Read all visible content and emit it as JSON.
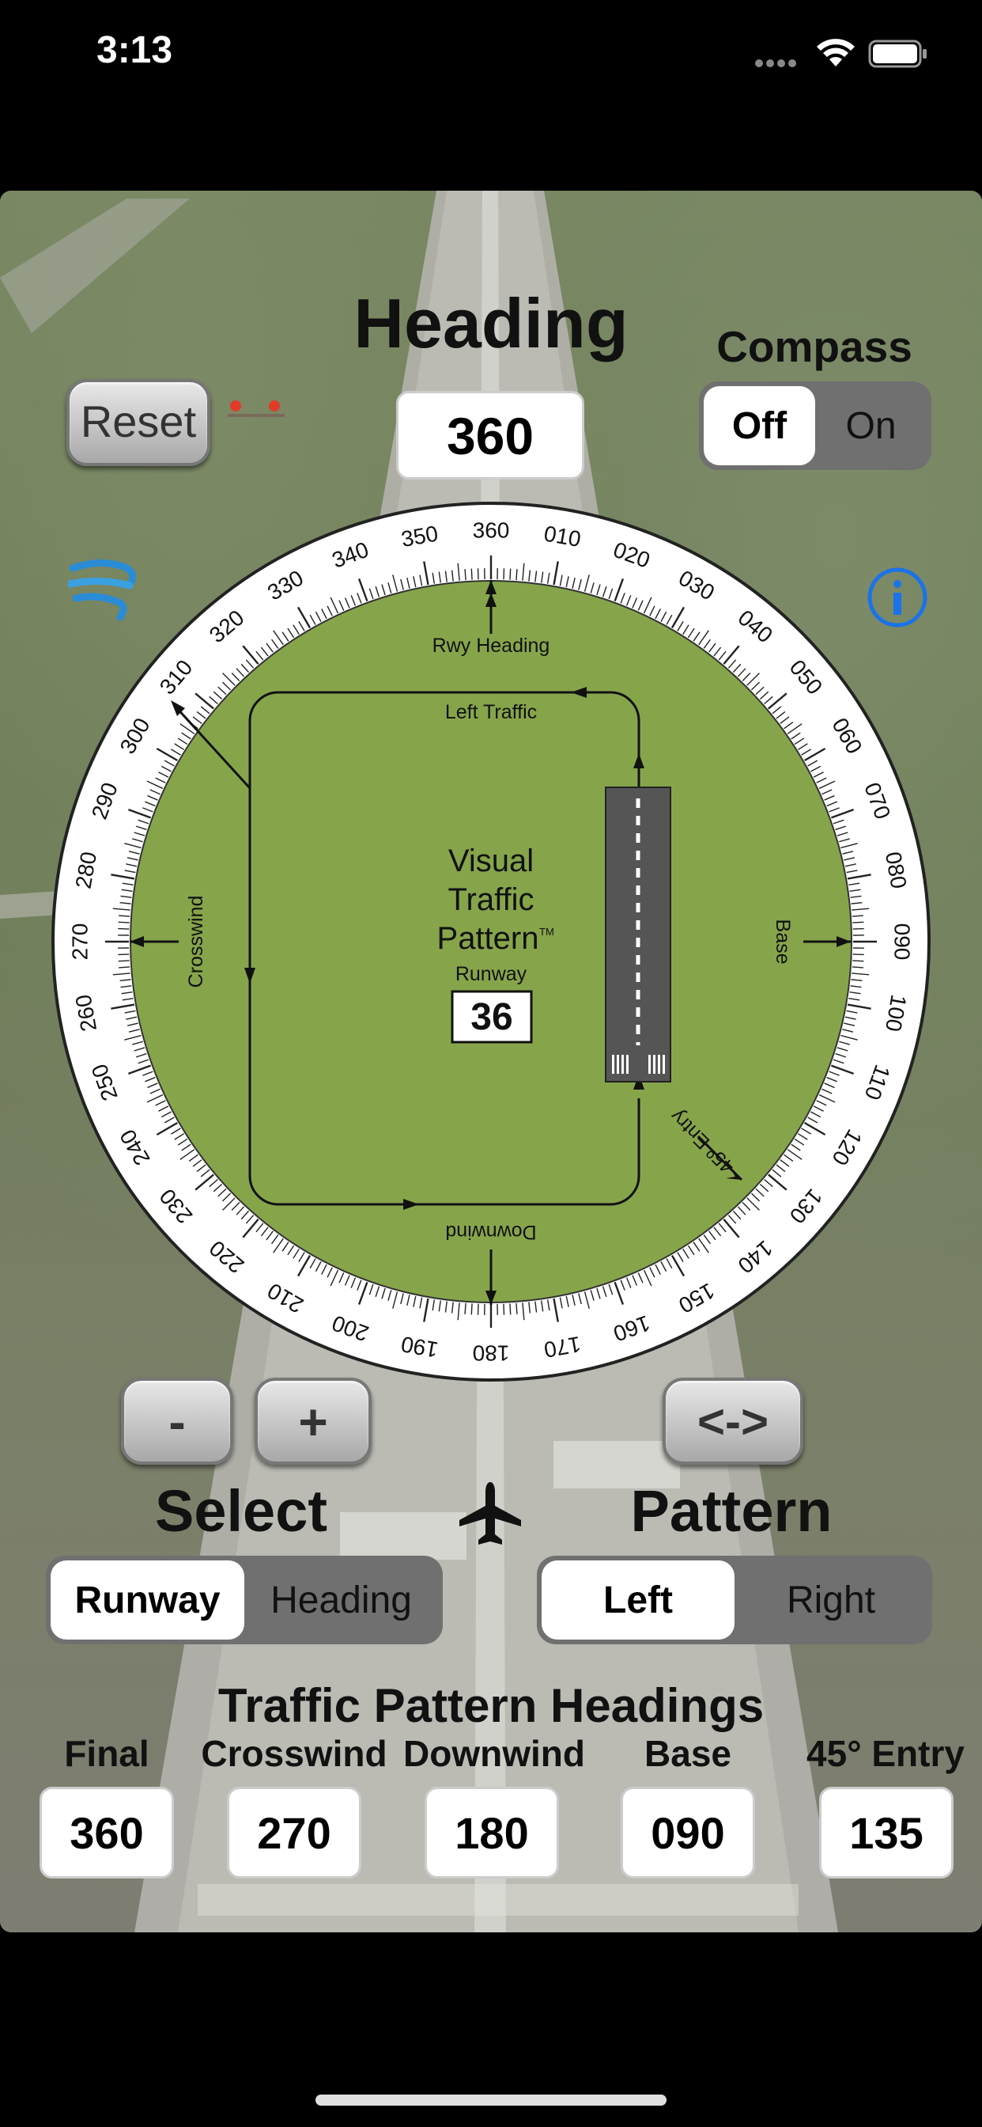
{
  "status_bar": {
    "time": "3:13"
  },
  "header": {
    "title": "Heading",
    "heading_value": "360",
    "compass_label": "Compass",
    "compass_options": [
      "Off",
      "On"
    ],
    "compass_selected": "Off",
    "reset_label": "Reset"
  },
  "dial": {
    "degree_labels": [
      "360",
      "010",
      "020",
      "030",
      "040",
      "050",
      "060",
      "070",
      "080",
      "090",
      "100",
      "110",
      "120",
      "130",
      "140",
      "150",
      "160",
      "170",
      "180",
      "190",
      "200",
      "210",
      "220",
      "230",
      "240",
      "250",
      "260",
      "270",
      "280",
      "290",
      "300",
      "310",
      "320",
      "330",
      "340",
      "350"
    ],
    "rwy_heading_label": "Rwy Heading",
    "left_traffic_label": "Left Traffic",
    "crosswind_label": "Crosswind",
    "base_label": "Base",
    "downwind_label": "Downwind",
    "entry_label": "45º Entry",
    "center_line1": "Visual",
    "center_line2": "Traffic",
    "center_line3": "Pattern",
    "trademark": "TM",
    "runway_label": "Runway",
    "runway_number": "36"
  },
  "controls": {
    "minus_label": "-",
    "plus_label": "+",
    "swap_label": "<->",
    "select_label": "Select",
    "pattern_label": "Pattern",
    "select_options": [
      "Runway",
      "Heading"
    ],
    "select_selected": "Runway",
    "pattern_options": [
      "Left",
      "Right"
    ],
    "pattern_selected": "Left"
  },
  "traffic_pattern": {
    "title": "Traffic Pattern Headings",
    "columns": [
      {
        "label": "Final",
        "value": "360"
      },
      {
        "label": "Crosswind",
        "value": "270"
      },
      {
        "label": "Downwind",
        "value": "180"
      },
      {
        "label": "Base",
        "value": "090"
      },
      {
        "label": "45° Entry",
        "value": "135"
      }
    ]
  },
  "colors": {
    "dial_green": "#86a54b",
    "ios_blue": "#1a73e8",
    "segment_track": "#707070"
  }
}
